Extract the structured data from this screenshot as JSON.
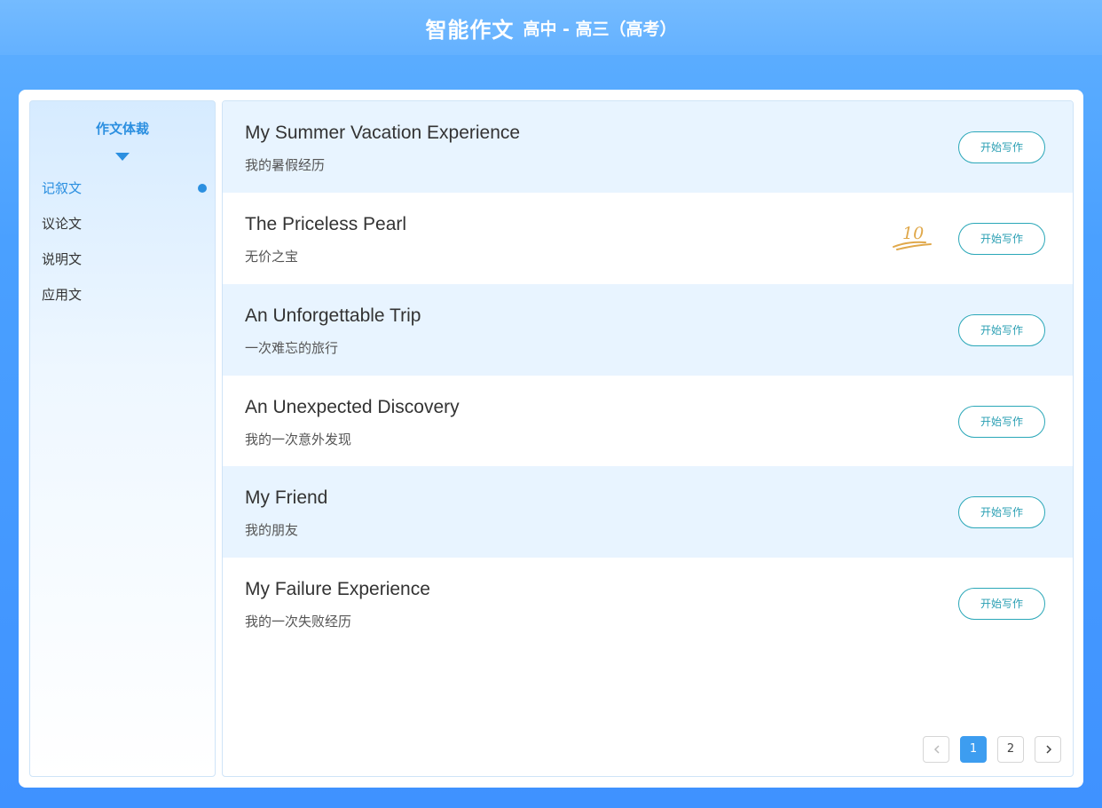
{
  "header": {
    "title": "智能作文",
    "subtitle": "高中 - 高三（高考）"
  },
  "sidebar": {
    "title": "作文体裁",
    "items": [
      {
        "label": "记叙文",
        "active": true
      },
      {
        "label": "议论文",
        "active": false
      },
      {
        "label": "说明文",
        "active": false
      },
      {
        "label": "应用文",
        "active": false
      }
    ]
  },
  "essays": [
    {
      "title_en": "My Summer Vacation Experience",
      "title_zh": "我的暑假经历",
      "button": "开始写作"
    },
    {
      "title_en": "The Priceless Pearl",
      "title_zh": "无价之宝",
      "button": "开始写作",
      "score": "10"
    },
    {
      "title_en": "An Unforgettable Trip",
      "title_zh": "一次难忘的旅行",
      "button": "开始写作"
    },
    {
      "title_en": "An Unexpected Discovery",
      "title_zh": "我的一次意外发现",
      "button": "开始写作"
    },
    {
      "title_en": "My Friend",
      "title_zh": "我的朋友",
      "button": "开始写作"
    },
    {
      "title_en": "My Failure Experience",
      "title_zh": "我的一次失败经历",
      "button": "开始写作"
    }
  ],
  "pagination": {
    "pages": [
      "1",
      "2"
    ],
    "current": "1"
  },
  "colors": {
    "accent": "#2b8fe0",
    "row_alt": "#e8f4ff",
    "button_border": "#2aa7b8",
    "score": "#e0a84a"
  }
}
